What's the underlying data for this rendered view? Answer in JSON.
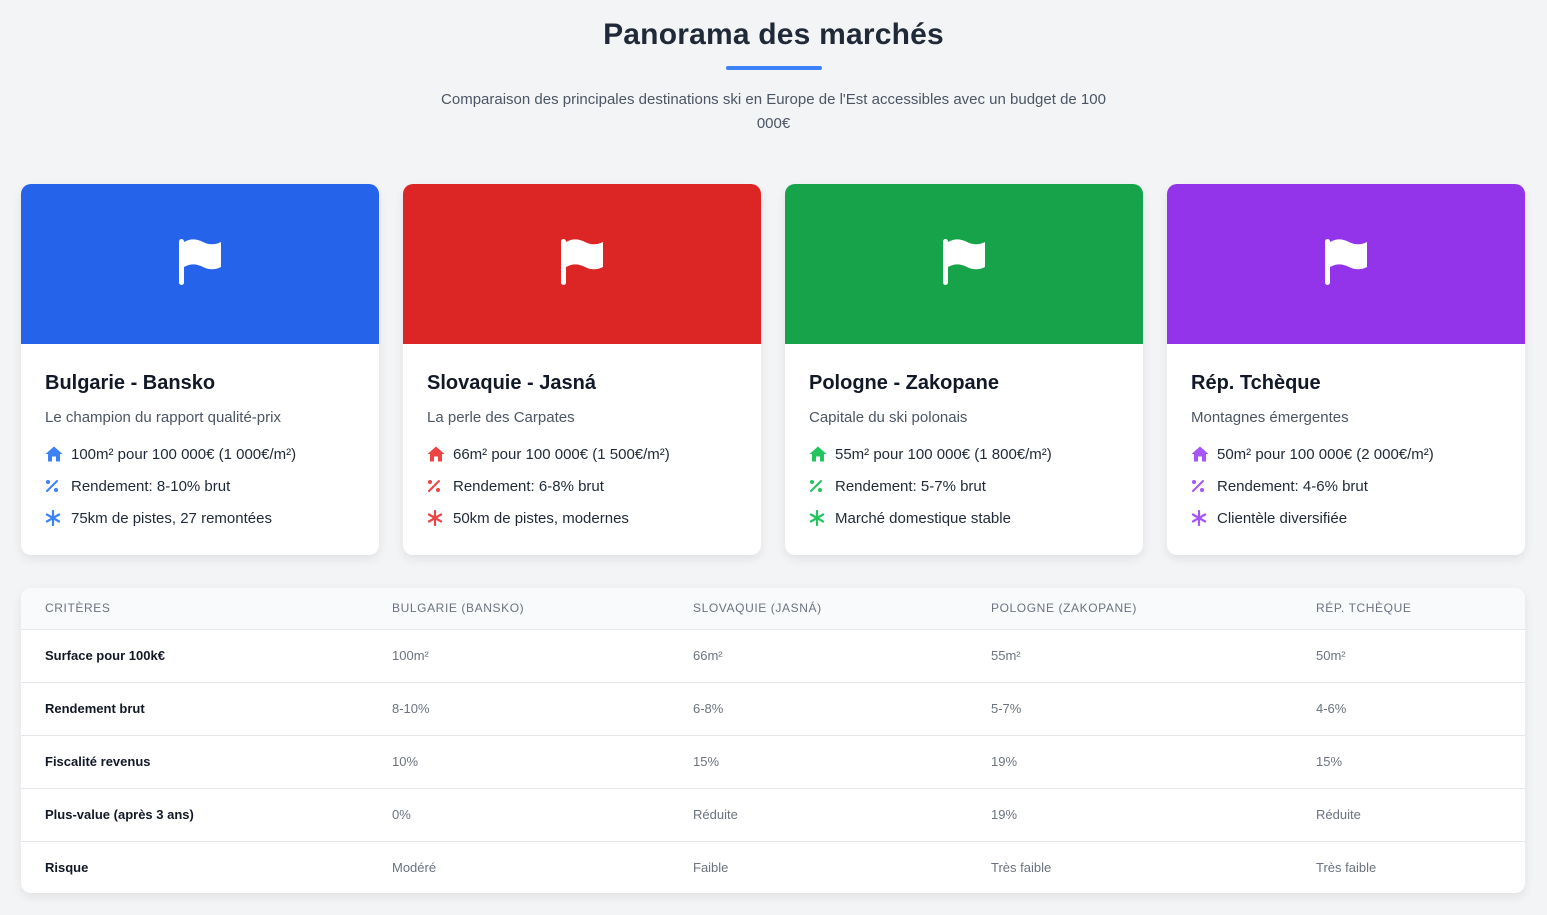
{
  "header": {
    "title": "Panorama des marchés",
    "subtitle": "Comparaison des principales destinations ski en Europe de l'Est accessibles avec un budget de 100 000€"
  },
  "cards": [
    {
      "color": "#2563eb",
      "accent": "#3b82f6",
      "banner_icon": "flag-icon",
      "title": "Bulgarie - Bansko",
      "subtitle": "Le champion du rapport qualité-prix",
      "features": [
        {
          "icon": "home-icon",
          "text": "100m² pour 100 000€ (1 000€/m²)"
        },
        {
          "icon": "percent-icon",
          "text": "Rendement: 8-10% brut"
        },
        {
          "icon": "snowflake-icon",
          "text": "75km de pistes, 27 remontées"
        }
      ]
    },
    {
      "color": "#dc2626",
      "accent": "#ef4444",
      "banner_icon": "flag-icon",
      "title": "Slovaquie - Jasná",
      "subtitle": "La perle des Carpates",
      "features": [
        {
          "icon": "home-icon",
          "text": "66m² pour 100 000€ (1 500€/m²)"
        },
        {
          "icon": "percent-icon",
          "text": "Rendement: 6-8% brut"
        },
        {
          "icon": "snowflake-icon",
          "text": "50km de pistes, modernes"
        }
      ]
    },
    {
      "color": "#16a34a",
      "accent": "#22c55e",
      "banner_icon": "flag-icon",
      "title": "Pologne - Zakopane",
      "subtitle": "Capitale du ski polonais",
      "features": [
        {
          "icon": "home-icon",
          "text": "55m² pour 100 000€ (1 800€/m²)"
        },
        {
          "icon": "percent-icon",
          "text": "Rendement: 5-7% brut"
        },
        {
          "icon": "snowflake-icon",
          "text": "Marché domestique stable"
        }
      ]
    },
    {
      "color": "#9333ea",
      "accent": "#a855f7",
      "banner_icon": "flag-icon",
      "title": "Rép. Tchèque",
      "subtitle": "Montagnes émergentes",
      "features": [
        {
          "icon": "home-icon",
          "text": "50m² pour 100 000€ (2 000€/m²)"
        },
        {
          "icon": "percent-icon",
          "text": "Rendement: 4-6% brut"
        },
        {
          "icon": "snowflake-icon",
          "text": "Clientèle diversifiée"
        }
      ]
    }
  ],
  "table": {
    "headers": [
      "Critères",
      "Bulgarie (Bansko)",
      "Slovaquie (Jasná)",
      "Pologne (Zakopane)",
      "Rép. Tchèque"
    ],
    "rows": [
      [
        "Surface pour 100k€",
        "100m²",
        "66m²",
        "55m²",
        "50m²"
      ],
      [
        "Rendement brut",
        "8-10%",
        "6-8%",
        "5-7%",
        "4-6%"
      ],
      [
        "Fiscalité revenus",
        "10%",
        "15%",
        "19%",
        "15%"
      ],
      [
        "Plus-value (après 3 ans)",
        "0%",
        "Réduite",
        "19%",
        "Réduite"
      ],
      [
        "Risque",
        "Modéré",
        "Faible",
        "Très faible",
        "Très faible"
      ]
    ]
  }
}
